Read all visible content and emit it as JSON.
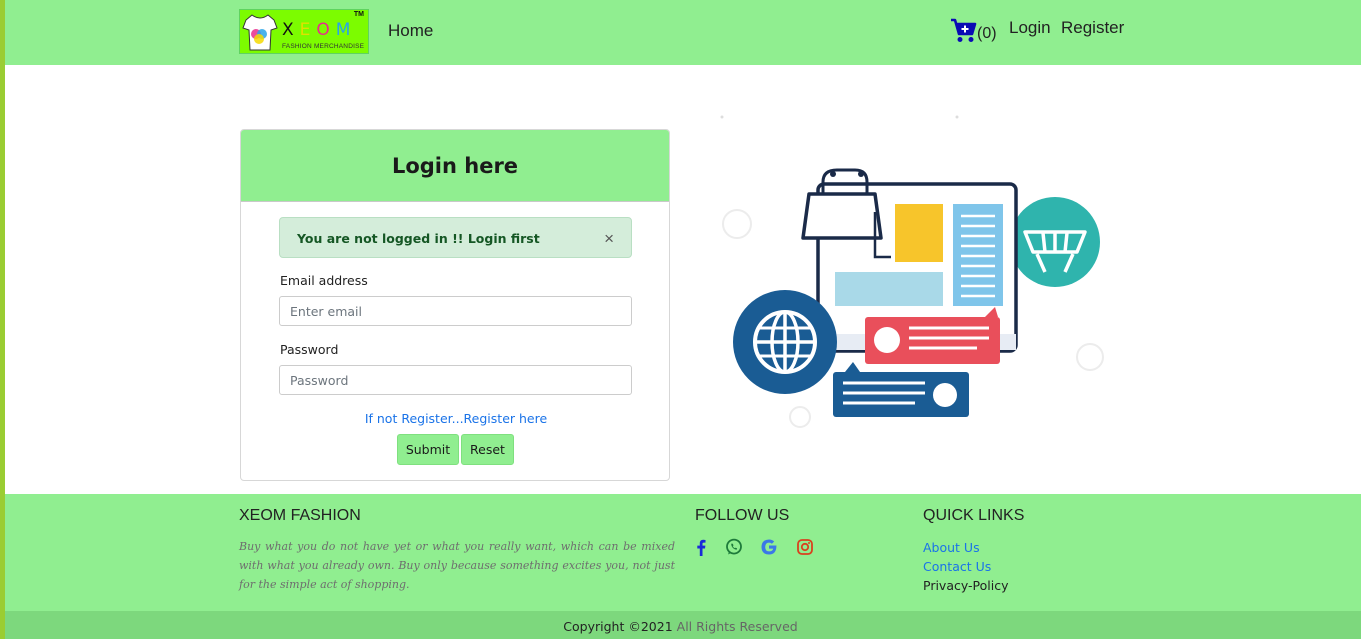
{
  "header": {
    "logo": {
      "brand_letters": [
        "X",
        "E",
        "O",
        "M"
      ],
      "tagline": "FASHION MERCHANDISE",
      "trademark": "TM"
    },
    "nav_home": "Home",
    "cart_count": "(0)",
    "nav_login": "Login",
    "nav_register": "Register"
  },
  "login_card": {
    "title": "Login here",
    "alert": {
      "message": "You are not logged in !! Login first",
      "close": "×"
    },
    "email_label": "Email address",
    "email_placeholder": "Enter email",
    "password_label": "Password",
    "password_placeholder": "Password",
    "register_link": "If not Register...Register here",
    "submit_label": "Submit",
    "reset_label": "Reset"
  },
  "footer": {
    "brand_title": "XEOM FASHION",
    "description": "Buy what you do not have yet or what you really want, which can be mixed with what you already own. Buy only because something excites you, not just for the simple act of shopping.",
    "follow_title": "FOLLOW US",
    "social_icons": [
      "facebook-icon",
      "whatsapp-icon",
      "google-icon",
      "instagram-icon"
    ],
    "quick_links_title": "QUICK LINKS",
    "quick_links": [
      "About Us",
      "Contact Us",
      "Privacy-Policy"
    ],
    "copyright": "Copyright ©2021",
    "rights": "All Rights Reserved"
  },
  "colors": {
    "nav_green": "#90ee90",
    "logo_green": "#7cfc00",
    "link_blue": "#1a73e8",
    "alert_bg": "#d4edda",
    "alert_text": "#155724"
  }
}
